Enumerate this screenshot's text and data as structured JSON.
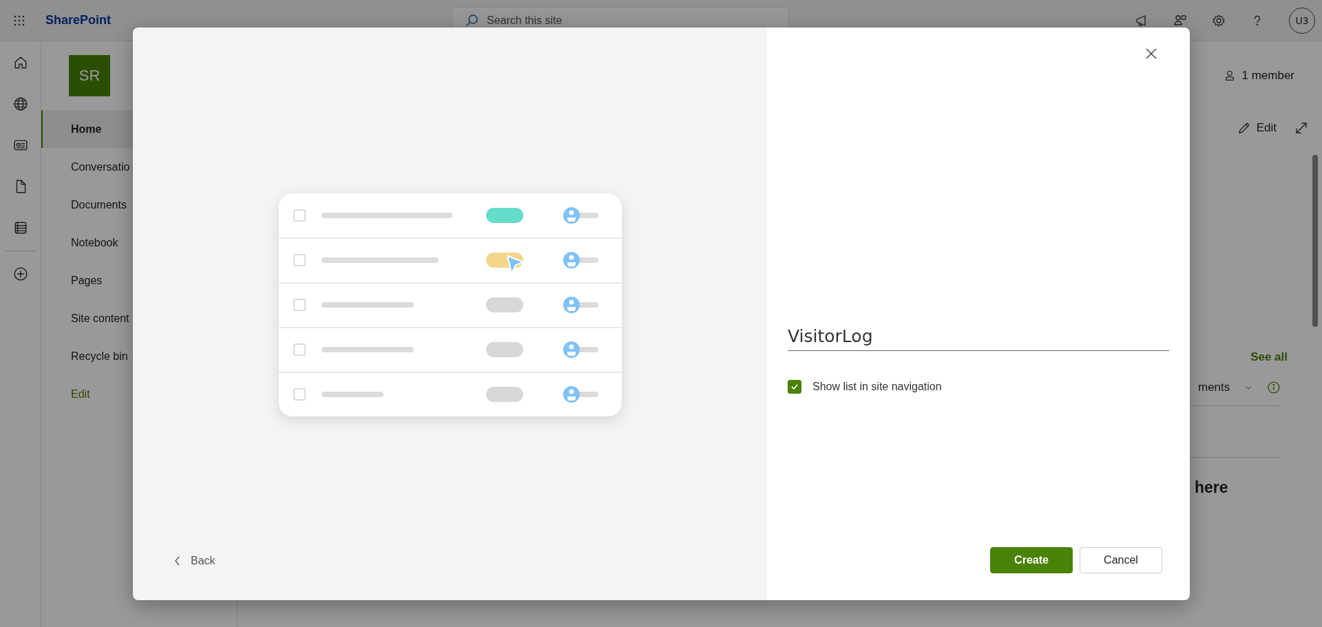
{
  "top_bar": {
    "app_name": "SharePoint",
    "search": {
      "placeholder": "Search this site"
    },
    "avatar": "U3"
  },
  "site": {
    "logo": "SR",
    "nav": [
      {
        "label": "Home",
        "selected": true
      },
      {
        "label": "Conversatio",
        "selected": false
      },
      {
        "label": "Documents",
        "selected": false
      },
      {
        "label": "Notebook",
        "selected": false
      },
      {
        "label": "Pages",
        "selected": false
      },
      {
        "label": "Site content",
        "selected": false
      },
      {
        "label": "Recycle bin",
        "selected": false
      }
    ],
    "edit_link": "Edit"
  },
  "page": {
    "members": "1 member",
    "edit": "Edit",
    "see_all": "See all",
    "filter": "ments",
    "heading": "here"
  },
  "dialog": {
    "name_field": {
      "value": "VisitorLog"
    },
    "checkbox": {
      "label": "Show list in site navigation",
      "checked": true
    },
    "back": "Back",
    "buttons": [
      {
        "label": "Create",
        "kind": "primary"
      },
      {
        "label": "Cancel",
        "kind": "secondary"
      }
    ]
  }
}
